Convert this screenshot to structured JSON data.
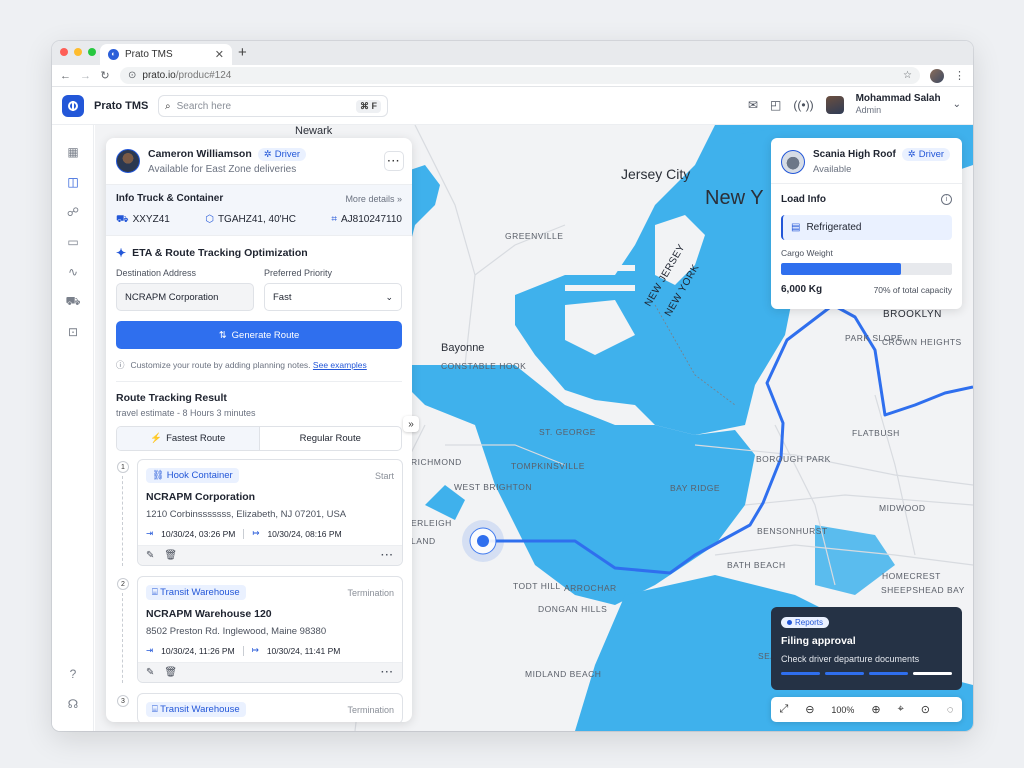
{
  "browser": {
    "tab_title": "Prato TMS",
    "url_host": "prato.io",
    "url_path": "/produc#124"
  },
  "header": {
    "app_name": "Prato TMS",
    "search_placeholder": "Search here",
    "search_shortcut": "⌘ F",
    "user_name": "Mohammad Salah",
    "user_role": "Admin"
  },
  "sidebar": {
    "items": [
      {
        "icon": "grid-icon"
      },
      {
        "icon": "map-icon",
        "active": true
      },
      {
        "icon": "users-icon"
      },
      {
        "icon": "book-icon"
      },
      {
        "icon": "activity-icon"
      },
      {
        "icon": "truck-icon"
      },
      {
        "icon": "money-icon"
      }
    ],
    "bottom": [
      {
        "icon": "help-icon"
      },
      {
        "icon": "headset-icon"
      }
    ]
  },
  "driver": {
    "name": "Cameron Williamson",
    "badge": "Driver",
    "status": "Available for East Zone deliveries"
  },
  "truck_info": {
    "title": "Info Truck & Container",
    "more": "More details",
    "plate": "XXYZ41",
    "container": "TGAHZ41, 40'HC",
    "id": "AJ810247110"
  },
  "eta": {
    "title": "ETA & Route Tracking Optimization",
    "destination_label": "Destination Address",
    "destination_value": "NCRAPM Corporation",
    "priority_label": "Preferred Priority",
    "priority_value": "Fast",
    "generate_label": "Generate Route",
    "hint": "Customize your route by adding planning notes.",
    "hint_link": "See examples"
  },
  "result": {
    "title": "Route Tracking Result",
    "estimate": "travel estimate -  8 Hours 3 minutes",
    "tab_fastest": "Fastest Route",
    "tab_regular": "Regular Route",
    "steps": [
      {
        "num": "1",
        "badge": "Hook Container",
        "kind": "Start",
        "name": "NCRAPM Corporation",
        "address": "1210 Corbinsssssss, Elizabeth, NJ 07201, USA",
        "time_in": "10/30/24, 03:26 PM",
        "time_out": "10/30/24, 08:16 PM"
      },
      {
        "num": "2",
        "badge": "Transit Warehouse",
        "kind": "Termination",
        "name": "NCRAPM Warehouse 120",
        "address": "8502 Preston Rd. Inglewood, Maine 98380",
        "time_in": "10/30/24, 11:26 PM",
        "time_out": "10/30/24, 11:41 PM"
      },
      {
        "num": "3",
        "badge": "Transit Warehouse",
        "kind": "Termination"
      }
    ]
  },
  "vehicle": {
    "name": "Scania High Roof",
    "badge": "Driver",
    "status": "Available",
    "load_title": "Load Info",
    "load_type": "Refrigerated",
    "weight_label": "Cargo Weight",
    "weight_value": "6,000 Kg",
    "capacity_text": "70% of total capacity",
    "capacity_fraction": 0.7
  },
  "report": {
    "badge": "Reports",
    "title": "Filing approval",
    "subtitle": "Check driver departure documents"
  },
  "zoom": {
    "level": "100%"
  },
  "map_labels": [
    "Newark",
    "Jersey City",
    "New Y",
    "GREENVILLE",
    "BROOKLYN",
    "PARK SLOPE",
    "CROWN HEIGHTS",
    "Bayonne",
    "CONSTABLE HOOK",
    "NEW JERSEY",
    "NEW YORK",
    "ST. GEORGE",
    "FLATBUSH",
    "RICHMOND",
    "TOMPKINSVILLE",
    "BOROUGH PARK",
    "WEST BRIGHTON",
    "BAY RIDGE",
    "MIDWOOD",
    "ERLEIGH",
    "BENSONHURST",
    "LAND",
    "TODT HILL",
    "ARROCHAR",
    "BATH BEACH",
    "HOMECREST",
    "SHEEPSHEAD BAY",
    "DONGAN HILLS",
    "SEAGATE",
    "MIDLAND BEACH"
  ],
  "colors": {
    "accent": "#2357d8",
    "water": "#3fb1ec",
    "route": "#2f6fee"
  }
}
